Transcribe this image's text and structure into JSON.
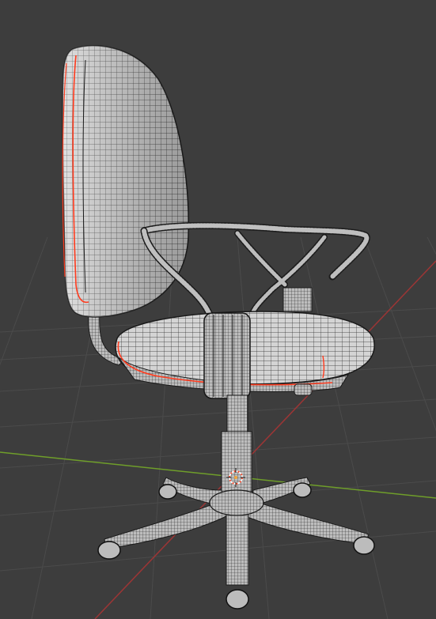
{
  "viewport": {
    "mode": "wireframe",
    "background_color": "#3d3d3d",
    "grid_color": "#4a4a4a",
    "x_axis_color": "#b23b3b",
    "y_axis_color": "#7bbd2a",
    "mesh_color": "#e8e8e8",
    "wire_color": "#1e1e1e",
    "seam_color": "#ff3b1e",
    "origin_marker": "3d-cursor-icon"
  },
  "object": {
    "name_shown": "",
    "parts": [
      "backrest",
      "backrest-support",
      "armrest-left",
      "armrest-right",
      "seat",
      "gas-lift",
      "star-base",
      "caster-wheels"
    ]
  }
}
